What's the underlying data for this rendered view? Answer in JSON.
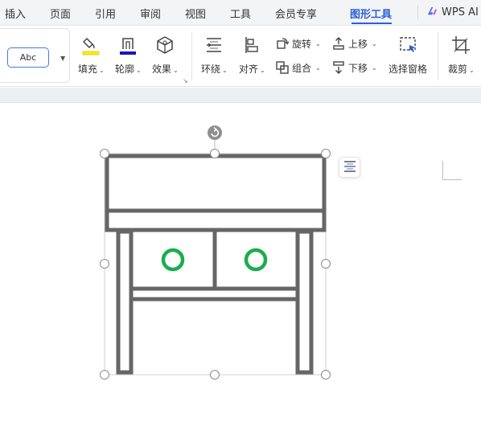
{
  "menu": {
    "tabs": [
      {
        "label": "插入"
      },
      {
        "label": "页面"
      },
      {
        "label": "引用"
      },
      {
        "label": "审阅"
      },
      {
        "label": "视图"
      },
      {
        "label": "工具"
      },
      {
        "label": "会员专享"
      },
      {
        "label": "图形工具",
        "active": true
      }
    ],
    "ai_label": "WPS AI"
  },
  "ribbon": {
    "style_preview": "Abc",
    "fill": "填充",
    "outline": "轮廓",
    "effect": "效果",
    "wrap": "环绕",
    "align": "对齐",
    "rotate": "旋转",
    "group": "组合",
    "bring_forward": "上移",
    "send_backward": "下移",
    "selection_pane": "选择窗格",
    "crop": "裁剪"
  },
  "colors": {
    "accent": "#2b5fd9",
    "fill_swatch": "#ffee00",
    "outline_swatch": "#1414c8",
    "shape_stroke": "#666666",
    "knob": "#1aad4e",
    "handle_stroke": "#8a8a8a"
  },
  "icons": [
    "wps-ai-icon",
    "fill-bucket-icon",
    "outline-pen-icon",
    "effect-cube-icon",
    "wrap-text-icon",
    "align-left-icon",
    "rotate-icon",
    "group-icon",
    "bring-forward-icon",
    "send-backward-icon",
    "selection-pane-icon",
    "crop-icon",
    "rotate-handle-icon",
    "layout-options-icon"
  ]
}
